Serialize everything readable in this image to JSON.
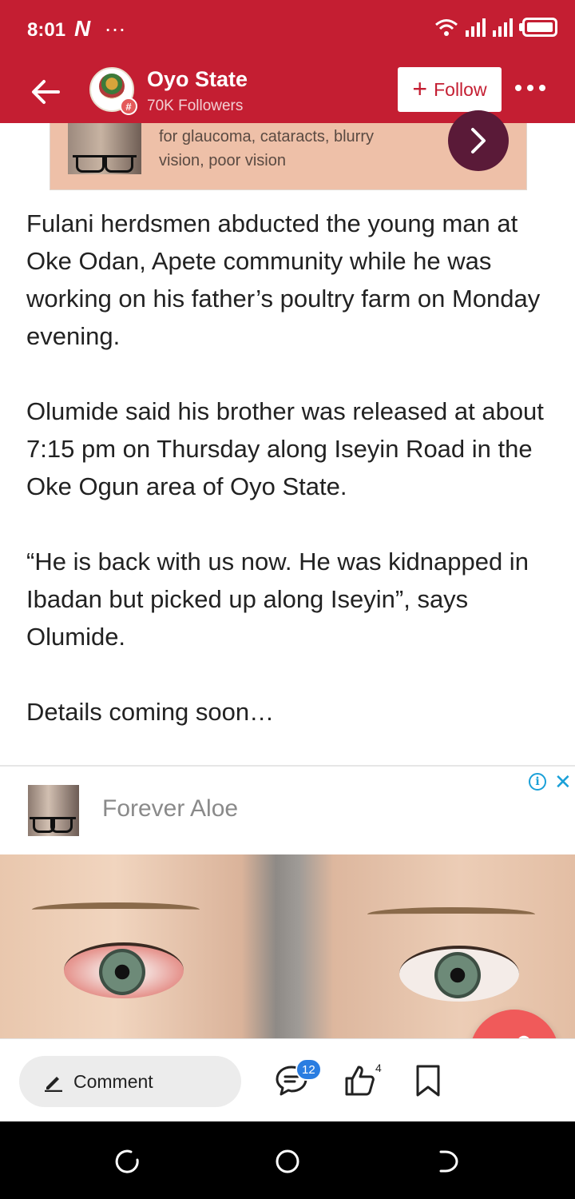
{
  "status_bar": {
    "time": "8:01",
    "notif_glyph": "N",
    "more_glyph": "…"
  },
  "header": {
    "back_icon": "arrow-left-icon",
    "channel_name": "Oyo State",
    "followers": "70K Followers",
    "follow_plus": "+",
    "follow_label": "Follow",
    "more_icon": "more-dots-icon",
    "badge_symbol": "#",
    "brand_color": "#c41e32"
  },
  "top_ad": {
    "line1": "for glaucoma, cataracts, blurry",
    "line2": "vision, poor vision",
    "arrow": "›"
  },
  "article": {
    "paragraphs": [
      "Fulani herdsmen abducted the young man at Oke Odan, Apete community while he was working on his father’s poultry farm on Monday evening.",
      "Olumide said his brother was released at about 7:15 pm on Thursday along Iseyin Road in the Oke Ogun area of Oyo State.",
      "“He is back with us now. He was kidnapped in Ibadan but picked up along Iseyin”, says Olumide.",
      "Details coming soon…"
    ]
  },
  "bottom_ad": {
    "advertiser": "Forever Aloe",
    "info_glyph": "i",
    "close_glyph": "✕"
  },
  "actions": {
    "comment_label": "Comment",
    "comment_count": "12",
    "like_count": "4"
  }
}
